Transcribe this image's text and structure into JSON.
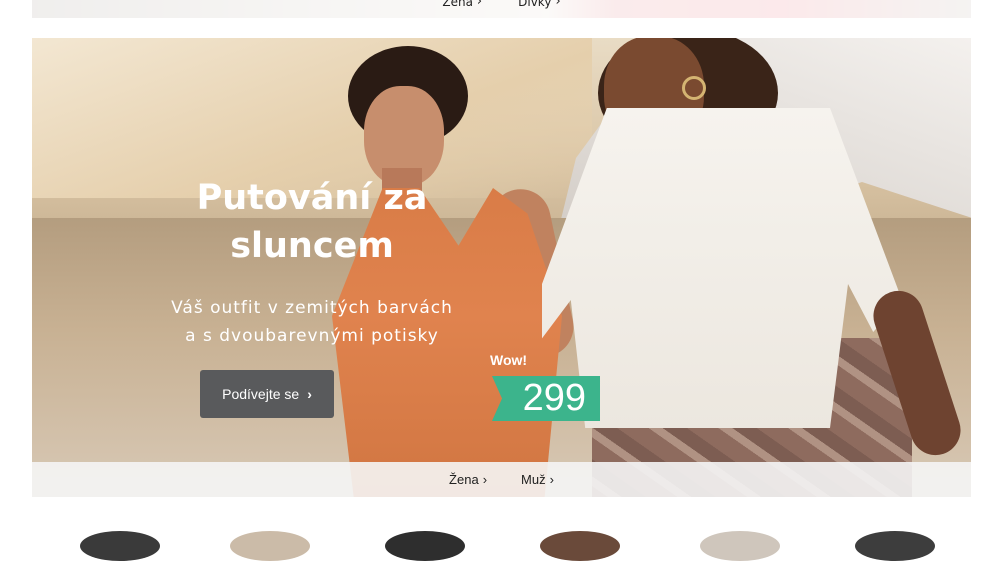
{
  "top_banner": {
    "links": [
      {
        "label": "Žena"
      },
      {
        "label": "Dívky"
      }
    ]
  },
  "hero": {
    "title": "Putování za sluncem",
    "subtitle_lines": [
      "Váš outfit v zemitých barvách",
      "a s dvoubarevnými potisky"
    ],
    "cta_label": "Podívejte se",
    "badge_text": "Wow!",
    "price": "299",
    "accent_color": "#3cb48c",
    "button_color": "#595a5c"
  },
  "links_bar": {
    "links": [
      {
        "label": "Žena"
      },
      {
        "label": "Muž"
      }
    ]
  },
  "icons": {
    "chevron": "chevron-right-icon"
  }
}
